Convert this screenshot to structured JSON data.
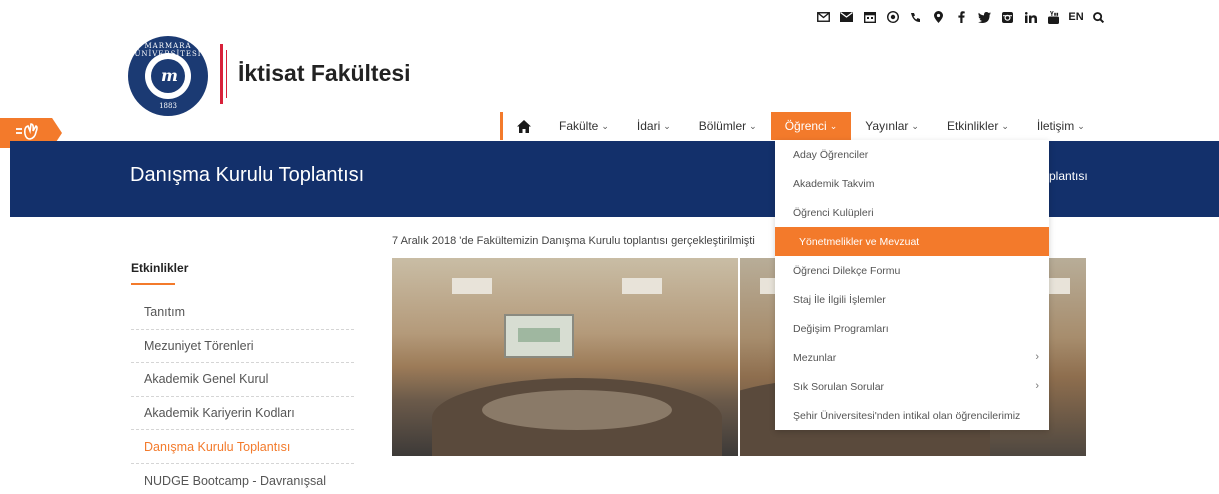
{
  "topbar": {
    "icons": [
      "envelope-outline-icon",
      "envelope-icon",
      "calendar-icon",
      "globe-icon",
      "phone-icon",
      "map-marker-icon",
      "facebook-icon",
      "twitter-icon",
      "instagram-icon",
      "linkedin-icon",
      "youtube-icon"
    ],
    "lang_label": "EN",
    "search_icon": "search-icon"
  },
  "header": {
    "logo": {
      "arc_text": "MARMARA ÜNİVERSİTESİ",
      "year": "1883",
      "mark": "m"
    },
    "faculty_title": "İktisat Fakültesi"
  },
  "side_tab": {
    "icon": "hand-wave-icon"
  },
  "nav": {
    "home_icon": "home-icon",
    "items": [
      {
        "label": "Fakülte",
        "active": false
      },
      {
        "label": "İdari",
        "active": false
      },
      {
        "label": "Bölümler",
        "active": false
      },
      {
        "label": "Öğrenci",
        "active": true
      },
      {
        "label": "Yayınlar",
        "active": false
      },
      {
        "label": "Etkinlikler",
        "active": false
      },
      {
        "label": "İletişim",
        "active": false
      }
    ]
  },
  "banner": {
    "title": "Danışma Kurulu Toplantısı",
    "crumb_fragment": "plantısı"
  },
  "dropdown": {
    "items": [
      {
        "label": "Aday Öğrenciler",
        "active": false,
        "submenu": false
      },
      {
        "label": "Akademik Takvim",
        "active": false,
        "submenu": false
      },
      {
        "label": "Öğrenci Kulüpleri",
        "active": false,
        "submenu": false
      },
      {
        "label": "Yönetmelikler ve Mevzuat",
        "active": true,
        "submenu": false
      },
      {
        "label": "Öğrenci Dilekçe Formu",
        "active": false,
        "submenu": false
      },
      {
        "label": "Staj İle İlgili İşlemler",
        "active": false,
        "submenu": false
      },
      {
        "label": "Değişim Programları",
        "active": false,
        "submenu": false
      },
      {
        "label": "Mezunlar",
        "active": false,
        "submenu": true
      },
      {
        "label": "Sık Sorulan Sorular",
        "active": false,
        "submenu": true
      },
      {
        "label": "Şehir Üniversitesi'nden intikal olan öğrencilerimiz",
        "active": false,
        "submenu": false
      }
    ]
  },
  "sidebar": {
    "heading": "Etkinlikler",
    "items": [
      {
        "label": "Tanıtım",
        "active": false
      },
      {
        "label": "Mezuniyet Törenleri",
        "active": false
      },
      {
        "label": "Akademik Genel Kurul",
        "active": false
      },
      {
        "label": "Akademik Kariyerin Kodları",
        "active": false
      },
      {
        "label": "Danışma Kurulu Toplantısı",
        "active": true
      },
      {
        "label": "NUDGE Bootcamp - Davranışsal",
        "active": false
      }
    ]
  },
  "content": {
    "intro_text": "7 Aralık 2018 'de Fakültemizin Danışma Kurulu toplantısı gerçekleştirilmişti"
  },
  "colors": {
    "accent": "#f37a2b",
    "banner": "#13306b",
    "logo_red": "#d8213a"
  }
}
